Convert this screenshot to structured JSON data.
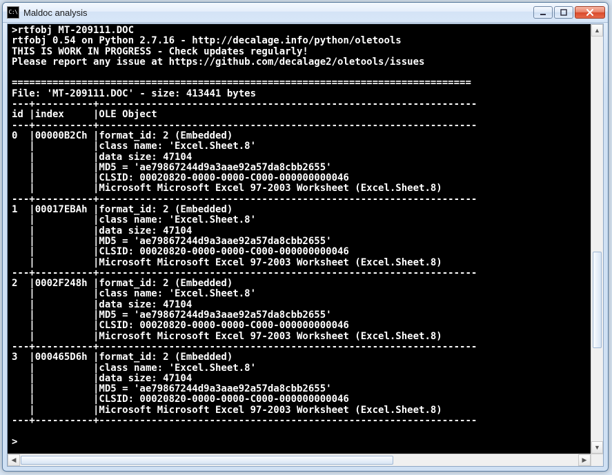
{
  "window": {
    "icon_text": "C:\\",
    "title": "Maldoc analysis"
  },
  "terminal": {
    "prompt_line": ">rtfobj MT-209111.DOC",
    "banner": [
      "rtfobj 0.54 on Python 2.7.16 - http://decalage.info/python/oletools",
      "THIS IS WORK IN PROGRESS - Check updates regularly!",
      "Please report any issue at https://github.com/decalage2/oletools/issues"
    ],
    "file_line": "File: 'MT-209111.DOC' - size: 413441 bytes",
    "header": {
      "col1": "id",
      "col2": "index",
      "col3": "OLE Object"
    },
    "rows": [
      {
        "id": "0",
        "index": "00000B2Ch",
        "lines": [
          "format_id: 2 (Embedded)",
          "class name: 'Excel.Sheet.8'",
          "data size: 47104",
          "MD5 = 'ae79867244d9a3aae92a57da8cbb2655'",
          "CLSID: 00020820-0000-0000-C000-000000000046",
          "Microsoft Microsoft Excel 97-2003 Worksheet (Excel.Sheet.8)"
        ]
      },
      {
        "id": "1",
        "index": "00017EBAh",
        "lines": [
          "format_id: 2 (Embedded)",
          "class name: 'Excel.Sheet.8'",
          "data size: 47104",
          "MD5 = 'ae79867244d9a3aae92a57da8cbb2655'",
          "CLSID: 00020820-0000-0000-C000-000000000046",
          "Microsoft Microsoft Excel 97-2003 Worksheet (Excel.Sheet.8)"
        ]
      },
      {
        "id": "2",
        "index": "0002F248h",
        "lines": [
          "format_id: 2 (Embedded)",
          "class name: 'Excel.Sheet.8'",
          "data size: 47104",
          "MD5 = 'ae79867244d9a3aae92a57da8cbb2655'",
          "CLSID: 00020820-0000-0000-C000-000000000046",
          "Microsoft Microsoft Excel 97-2003 Worksheet (Excel.Sheet.8)"
        ]
      },
      {
        "id": "3",
        "index": "000465D6h",
        "lines": [
          "format_id: 2 (Embedded)",
          "class name: 'Excel.Sheet.8'",
          "data size: 47104",
          "MD5 = 'ae79867244d9a3aae92a57da8cbb2655'",
          "CLSID: 00020820-0000-0000-C000-000000000046",
          "Microsoft Microsoft Excel 97-2003 Worksheet (Excel.Sheet.8)"
        ]
      }
    ],
    "final_prompt": ">"
  }
}
